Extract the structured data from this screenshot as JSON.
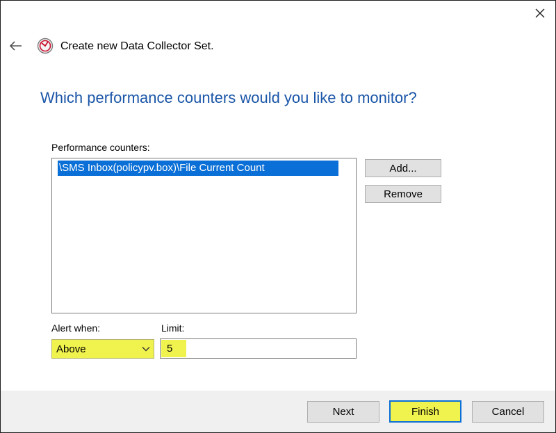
{
  "window": {
    "title": "Create new Data Collector Set."
  },
  "heading": "Which performance counters would you like to monitor?",
  "counters": {
    "label": "Performance counters:",
    "items": [
      "\\SMS Inbox(policypv.box)\\File Current Count"
    ],
    "add_label": "Add...",
    "remove_label": "Remove"
  },
  "alert": {
    "label": "Alert when:",
    "selected": "Above"
  },
  "limit": {
    "label": "Limit:",
    "value": "5"
  },
  "footer": {
    "next_label": "Next",
    "finish_label": "Finish",
    "cancel_label": "Cancel"
  },
  "colors": {
    "heading": "#1b56a8",
    "selection": "#0a6fd6",
    "highlight": "#f0f24d"
  },
  "icons": {
    "close": "close-icon",
    "back": "back-arrow-icon",
    "app": "performance-monitor-icon",
    "dropdown": "chevron-down-icon"
  }
}
